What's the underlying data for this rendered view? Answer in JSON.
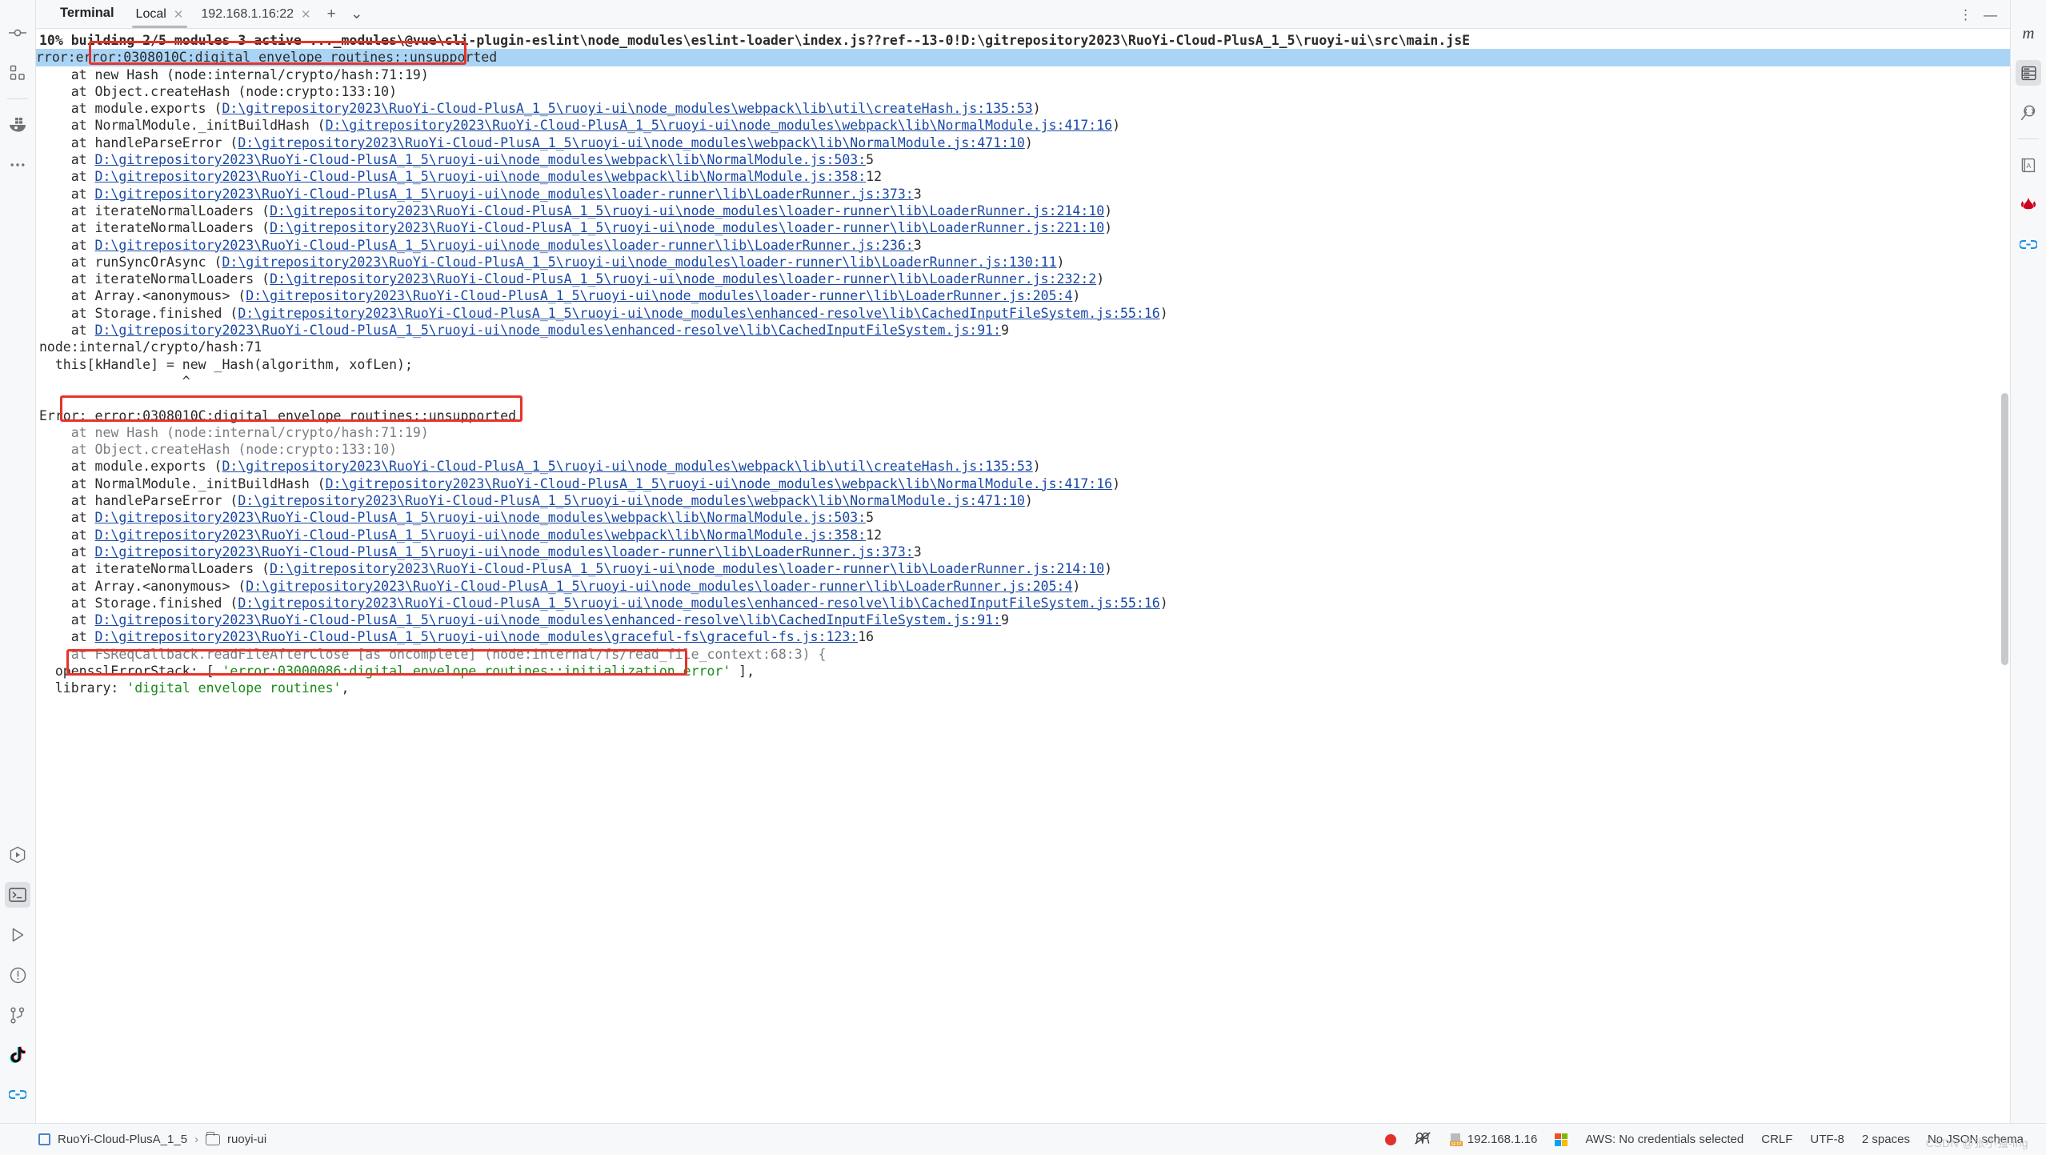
{
  "window": {
    "tool_window_title": "Terminal"
  },
  "tabs": [
    {
      "label": "Local",
      "active": true,
      "closable": true
    },
    {
      "label": "192.168.1.16:22",
      "active": false,
      "closable": true
    }
  ],
  "tab_controls": {
    "new_tab": "+",
    "dropdown": "⌄",
    "options": "⋮",
    "minimize": "—"
  },
  "left_rail": [
    {
      "name": "commit-icon",
      "title": "Commit"
    },
    {
      "name": "structure-icon",
      "title": "Structure"
    },
    {
      "name": "docker-icon",
      "title": "Services / Docker"
    },
    {
      "name": "more-tool-windows-icon",
      "title": "More Tool Windows"
    },
    {
      "name": "run-anything-icon",
      "title": "Run Anything"
    },
    {
      "name": "terminal-icon",
      "title": "Terminal"
    },
    {
      "name": "run-icon",
      "title": "Run"
    },
    {
      "name": "problems-icon",
      "title": "Problems"
    },
    {
      "name": "git-branch-icon",
      "title": "Git"
    },
    {
      "name": "tiktok-icon",
      "title": "TikTok"
    },
    {
      "name": "link-icon",
      "title": "Link"
    }
  ],
  "right_rail": [
    {
      "name": "maven-icon",
      "title": "Maven"
    },
    {
      "name": "database-icon",
      "title": "Database"
    },
    {
      "name": "code-search-icon",
      "title": "Code With Me"
    },
    {
      "name": "dictionary-icon",
      "title": "Translation"
    },
    {
      "name": "huawei-icon",
      "title": "Huawei"
    },
    {
      "name": "link-icon",
      "title": "Link"
    }
  ],
  "terminal": {
    "lines": [
      {
        "type": "progress",
        "text": "10% building 2/5 modules 3 active ..._modules\\@vue\\cli-plugin-eslint\\node_modules\\eslint-loader\\index.js??ref--13-0!D:\\gitrepository2023\\RuoYi-Cloud-PlusA_1_5\\ruoyi-ui\\src\\main.jsE"
      },
      {
        "type": "selected",
        "prefix": "rror",
        "sep": ":",
        "highlight": "error:0308010C:digital envelope routines::unsupported"
      },
      {
        "type": "plain",
        "text": "    at new Hash (node:internal/crypto/hash:71:19)"
      },
      {
        "type": "plain",
        "text": "    at Object.createHash (node:crypto:133:10)"
      },
      {
        "type": "link",
        "pre": "    at module.exports (",
        "link": "D:\\gitrepository2023\\RuoYi-Cloud-PlusA_1_5\\ruoyi-ui\\node_modules\\webpack\\lib\\util\\createHash.js:135:53",
        "post": ")"
      },
      {
        "type": "link",
        "pre": "    at NormalModule._initBuildHash (",
        "link": "D:\\gitrepository2023\\RuoYi-Cloud-PlusA_1_5\\ruoyi-ui\\node_modules\\webpack\\lib\\NormalModule.js:417:16",
        "post": ")"
      },
      {
        "type": "link",
        "pre": "    at handleParseError (",
        "link": "D:\\gitrepository2023\\RuoYi-Cloud-PlusA_1_5\\ruoyi-ui\\node_modules\\webpack\\lib\\NormalModule.js:471:10",
        "post": ")"
      },
      {
        "type": "link",
        "pre": "    at ",
        "link": "D:\\gitrepository2023\\RuoYi-Cloud-PlusA_1_5\\ruoyi-ui\\node_modules\\webpack\\lib\\NormalModule.js:503:",
        "post": "5"
      },
      {
        "type": "link",
        "pre": "    at ",
        "link": "D:\\gitrepository2023\\RuoYi-Cloud-PlusA_1_5\\ruoyi-ui\\node_modules\\webpack\\lib\\NormalModule.js:358:",
        "post": "12"
      },
      {
        "type": "link",
        "pre": "    at ",
        "link": "D:\\gitrepository2023\\RuoYi-Cloud-PlusA_1_5\\ruoyi-ui\\node_modules\\loader-runner\\lib\\LoaderRunner.js:373:",
        "post": "3"
      },
      {
        "type": "link",
        "pre": "    at iterateNormalLoaders (",
        "link": "D:\\gitrepository2023\\RuoYi-Cloud-PlusA_1_5\\ruoyi-ui\\node_modules\\loader-runner\\lib\\LoaderRunner.js:214:10",
        "post": ")"
      },
      {
        "type": "link",
        "pre": "    at iterateNormalLoaders (",
        "link": "D:\\gitrepository2023\\RuoYi-Cloud-PlusA_1_5\\ruoyi-ui\\node_modules\\loader-runner\\lib\\LoaderRunner.js:221:10",
        "post": ")"
      },
      {
        "type": "link",
        "pre": "    at ",
        "link": "D:\\gitrepository2023\\RuoYi-Cloud-PlusA_1_5\\ruoyi-ui\\node_modules\\loader-runner\\lib\\LoaderRunner.js:236:",
        "post": "3"
      },
      {
        "type": "link",
        "pre": "    at runSyncOrAsync (",
        "link": "D:\\gitrepository2023\\RuoYi-Cloud-PlusA_1_5\\ruoyi-ui\\node_modules\\loader-runner\\lib\\LoaderRunner.js:130:11",
        "post": ")"
      },
      {
        "type": "link",
        "pre": "    at iterateNormalLoaders (",
        "link": "D:\\gitrepository2023\\RuoYi-Cloud-PlusA_1_5\\ruoyi-ui\\node_modules\\loader-runner\\lib\\LoaderRunner.js:232:2",
        "post": ")"
      },
      {
        "type": "link",
        "pre": "    at Array.<anonymous> (",
        "link": "D:\\gitrepository2023\\RuoYi-Cloud-PlusA_1_5\\ruoyi-ui\\node_modules\\loader-runner\\lib\\LoaderRunner.js:205:4",
        "post": ")"
      },
      {
        "type": "link",
        "pre": "    at Storage.finished (",
        "link": "D:\\gitrepository2023\\RuoYi-Cloud-PlusA_1_5\\ruoyi-ui\\node_modules\\enhanced-resolve\\lib\\CachedInputFileSystem.js:55:16",
        "post": ")"
      },
      {
        "type": "link",
        "pre": "    at ",
        "link": "D:\\gitrepository2023\\RuoYi-Cloud-PlusA_1_5\\ruoyi-ui\\node_modules\\enhanced-resolve\\lib\\CachedInputFileSystem.js:91:",
        "post": "9"
      },
      {
        "type": "plain",
        "text": "node:internal/crypto/hash:71"
      },
      {
        "type": "plain",
        "text": "  this[kHandle] = new _Hash(algorithm, xofLen);"
      },
      {
        "type": "plain",
        "text": "                  ^"
      },
      {
        "type": "blank",
        "text": ""
      },
      {
        "type": "plain",
        "text": "Error: error:0308010C:digital envelope routines::unsupported"
      },
      {
        "type": "grey",
        "text": "    at new Hash (node:internal/crypto/hash:71:19)"
      },
      {
        "type": "grey",
        "text": "    at Object.createHash (node:crypto:133:10)"
      },
      {
        "type": "link",
        "pre": "    at module.exports (",
        "link": "D:\\gitrepository2023\\RuoYi-Cloud-PlusA_1_5\\ruoyi-ui\\node_modules\\webpack\\lib\\util\\createHash.js:135:53",
        "post": ")"
      },
      {
        "type": "link",
        "pre": "    at NormalModule._initBuildHash (",
        "link": "D:\\gitrepository2023\\RuoYi-Cloud-PlusA_1_5\\ruoyi-ui\\node_modules\\webpack\\lib\\NormalModule.js:417:16",
        "post": ")"
      },
      {
        "type": "link",
        "pre": "    at handleParseError (",
        "link": "D:\\gitrepository2023\\RuoYi-Cloud-PlusA_1_5\\ruoyi-ui\\node_modules\\webpack\\lib\\NormalModule.js:471:10",
        "post": ")"
      },
      {
        "type": "link",
        "pre": "    at ",
        "link": "D:\\gitrepository2023\\RuoYi-Cloud-PlusA_1_5\\ruoyi-ui\\node_modules\\webpack\\lib\\NormalModule.js:503:",
        "post": "5"
      },
      {
        "type": "link",
        "pre": "    at ",
        "link": "D:\\gitrepository2023\\RuoYi-Cloud-PlusA_1_5\\ruoyi-ui\\node_modules\\webpack\\lib\\NormalModule.js:358:",
        "post": "12"
      },
      {
        "type": "link",
        "pre": "    at ",
        "link": "D:\\gitrepository2023\\RuoYi-Cloud-PlusA_1_5\\ruoyi-ui\\node_modules\\loader-runner\\lib\\LoaderRunner.js:373:",
        "post": "3"
      },
      {
        "type": "link",
        "pre": "    at iterateNormalLoaders (",
        "link": "D:\\gitrepository2023\\RuoYi-Cloud-PlusA_1_5\\ruoyi-ui\\node_modules\\loader-runner\\lib\\LoaderRunner.js:214:10",
        "post": ")"
      },
      {
        "type": "link",
        "pre": "    at Array.<anonymous> (",
        "link": "D:\\gitrepository2023\\RuoYi-Cloud-PlusA_1_5\\ruoyi-ui\\node_modules\\loader-runner\\lib\\LoaderRunner.js:205:4",
        "post": ")"
      },
      {
        "type": "link",
        "pre": "    at Storage.finished (",
        "link": "D:\\gitrepository2023\\RuoYi-Cloud-PlusA_1_5\\ruoyi-ui\\node_modules\\enhanced-resolve\\lib\\CachedInputFileSystem.js:55:16",
        "post": ")"
      },
      {
        "type": "link",
        "pre": "    at ",
        "link": "D:\\gitrepository2023\\RuoYi-Cloud-PlusA_1_5\\ruoyi-ui\\node_modules\\enhanced-resolve\\lib\\CachedInputFileSystem.js:91:",
        "post": "9"
      },
      {
        "type": "link",
        "pre": "    at ",
        "link": "D:\\gitrepository2023\\RuoYi-Cloud-PlusA_1_5\\ruoyi-ui\\node_modules\\graceful-fs\\graceful-fs.js:123:",
        "post": "16"
      },
      {
        "type": "grey",
        "text": "    at FSReqCallback.readFileAfterClose [as oncomplete] (node:internal/fs/read_file_context:68:3) {"
      },
      {
        "type": "openssl",
        "pre": "  opensslErrorStack: [ ",
        "str": "'error:03000086:digital envelope routines::initialization error'",
        "post": " ],"
      },
      {
        "type": "libline",
        "pre": "  library: ",
        "str": "'digital envelope routines'",
        "post": ","
      }
    ]
  },
  "annotations": {
    "box1_label": "highlighted-error-box",
    "box2_label": "error-line-box",
    "box3_label": "openssl-error-stack-box"
  },
  "status_bar": {
    "project_name": "RuoYi-Cloud-PlusA_1_5",
    "separator": "›",
    "folder_name": "ruoyi-ui",
    "sftp_host": "192.168.1.16",
    "aws": "AWS: No credentials selected",
    "line_separator": "CRLF",
    "encoding": "UTF-8",
    "indent": "2 spaces",
    "json_schema": "No JSON schema",
    "watermark": "CSDN @张小强-ing"
  },
  "colors": {
    "link": "#1a49a5",
    "selection": "#aad4f5",
    "annotation_red": "#e8332a",
    "string_green": "#1a8a1a",
    "status_record": "#e0322a"
  }
}
